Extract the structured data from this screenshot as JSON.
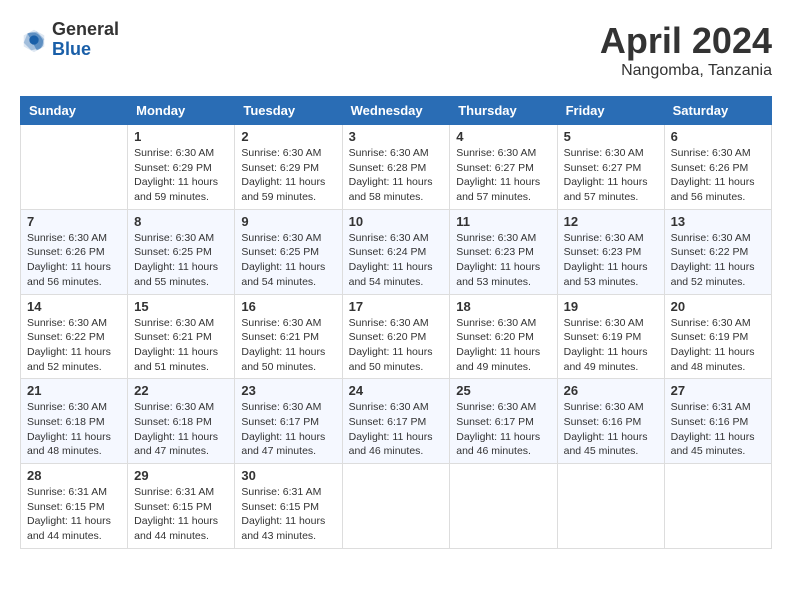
{
  "header": {
    "logo_general": "General",
    "logo_blue": "Blue",
    "month_title": "April 2024",
    "location": "Nangomba, Tanzania"
  },
  "calendar": {
    "days_of_week": [
      "Sunday",
      "Monday",
      "Tuesday",
      "Wednesday",
      "Thursday",
      "Friday",
      "Saturday"
    ],
    "weeks": [
      [
        {
          "day": "",
          "sunrise": "",
          "sunset": "",
          "daylight": ""
        },
        {
          "day": "1",
          "sunrise": "Sunrise: 6:30 AM",
          "sunset": "Sunset: 6:29 PM",
          "daylight": "Daylight: 11 hours and 59 minutes."
        },
        {
          "day": "2",
          "sunrise": "Sunrise: 6:30 AM",
          "sunset": "Sunset: 6:29 PM",
          "daylight": "Daylight: 11 hours and 59 minutes."
        },
        {
          "day": "3",
          "sunrise": "Sunrise: 6:30 AM",
          "sunset": "Sunset: 6:28 PM",
          "daylight": "Daylight: 11 hours and 58 minutes."
        },
        {
          "day": "4",
          "sunrise": "Sunrise: 6:30 AM",
          "sunset": "Sunset: 6:27 PM",
          "daylight": "Daylight: 11 hours and 57 minutes."
        },
        {
          "day": "5",
          "sunrise": "Sunrise: 6:30 AM",
          "sunset": "Sunset: 6:27 PM",
          "daylight": "Daylight: 11 hours and 57 minutes."
        },
        {
          "day": "6",
          "sunrise": "Sunrise: 6:30 AM",
          "sunset": "Sunset: 6:26 PM",
          "daylight": "Daylight: 11 hours and 56 minutes."
        }
      ],
      [
        {
          "day": "7",
          "sunrise": "Sunrise: 6:30 AM",
          "sunset": "Sunset: 6:26 PM",
          "daylight": "Daylight: 11 hours and 56 minutes."
        },
        {
          "day": "8",
          "sunrise": "Sunrise: 6:30 AM",
          "sunset": "Sunset: 6:25 PM",
          "daylight": "Daylight: 11 hours and 55 minutes."
        },
        {
          "day": "9",
          "sunrise": "Sunrise: 6:30 AM",
          "sunset": "Sunset: 6:25 PM",
          "daylight": "Daylight: 11 hours and 54 minutes."
        },
        {
          "day": "10",
          "sunrise": "Sunrise: 6:30 AM",
          "sunset": "Sunset: 6:24 PM",
          "daylight": "Daylight: 11 hours and 54 minutes."
        },
        {
          "day": "11",
          "sunrise": "Sunrise: 6:30 AM",
          "sunset": "Sunset: 6:23 PM",
          "daylight": "Daylight: 11 hours and 53 minutes."
        },
        {
          "day": "12",
          "sunrise": "Sunrise: 6:30 AM",
          "sunset": "Sunset: 6:23 PM",
          "daylight": "Daylight: 11 hours and 53 minutes."
        },
        {
          "day": "13",
          "sunrise": "Sunrise: 6:30 AM",
          "sunset": "Sunset: 6:22 PM",
          "daylight": "Daylight: 11 hours and 52 minutes."
        }
      ],
      [
        {
          "day": "14",
          "sunrise": "Sunrise: 6:30 AM",
          "sunset": "Sunset: 6:22 PM",
          "daylight": "Daylight: 11 hours and 52 minutes."
        },
        {
          "day": "15",
          "sunrise": "Sunrise: 6:30 AM",
          "sunset": "Sunset: 6:21 PM",
          "daylight": "Daylight: 11 hours and 51 minutes."
        },
        {
          "day": "16",
          "sunrise": "Sunrise: 6:30 AM",
          "sunset": "Sunset: 6:21 PM",
          "daylight": "Daylight: 11 hours and 50 minutes."
        },
        {
          "day": "17",
          "sunrise": "Sunrise: 6:30 AM",
          "sunset": "Sunset: 6:20 PM",
          "daylight": "Daylight: 11 hours and 50 minutes."
        },
        {
          "day": "18",
          "sunrise": "Sunrise: 6:30 AM",
          "sunset": "Sunset: 6:20 PM",
          "daylight": "Daylight: 11 hours and 49 minutes."
        },
        {
          "day": "19",
          "sunrise": "Sunrise: 6:30 AM",
          "sunset": "Sunset: 6:19 PM",
          "daylight": "Daylight: 11 hours and 49 minutes."
        },
        {
          "day": "20",
          "sunrise": "Sunrise: 6:30 AM",
          "sunset": "Sunset: 6:19 PM",
          "daylight": "Daylight: 11 hours and 48 minutes."
        }
      ],
      [
        {
          "day": "21",
          "sunrise": "Sunrise: 6:30 AM",
          "sunset": "Sunset: 6:18 PM",
          "daylight": "Daylight: 11 hours and 48 minutes."
        },
        {
          "day": "22",
          "sunrise": "Sunrise: 6:30 AM",
          "sunset": "Sunset: 6:18 PM",
          "daylight": "Daylight: 11 hours and 47 minutes."
        },
        {
          "day": "23",
          "sunrise": "Sunrise: 6:30 AM",
          "sunset": "Sunset: 6:17 PM",
          "daylight": "Daylight: 11 hours and 47 minutes."
        },
        {
          "day": "24",
          "sunrise": "Sunrise: 6:30 AM",
          "sunset": "Sunset: 6:17 PM",
          "daylight": "Daylight: 11 hours and 46 minutes."
        },
        {
          "day": "25",
          "sunrise": "Sunrise: 6:30 AM",
          "sunset": "Sunset: 6:17 PM",
          "daylight": "Daylight: 11 hours and 46 minutes."
        },
        {
          "day": "26",
          "sunrise": "Sunrise: 6:30 AM",
          "sunset": "Sunset: 6:16 PM",
          "daylight": "Daylight: 11 hours and 45 minutes."
        },
        {
          "day": "27",
          "sunrise": "Sunrise: 6:31 AM",
          "sunset": "Sunset: 6:16 PM",
          "daylight": "Daylight: 11 hours and 45 minutes."
        }
      ],
      [
        {
          "day": "28",
          "sunrise": "Sunrise: 6:31 AM",
          "sunset": "Sunset: 6:15 PM",
          "daylight": "Daylight: 11 hours and 44 minutes."
        },
        {
          "day": "29",
          "sunrise": "Sunrise: 6:31 AM",
          "sunset": "Sunset: 6:15 PM",
          "daylight": "Daylight: 11 hours and 44 minutes."
        },
        {
          "day": "30",
          "sunrise": "Sunrise: 6:31 AM",
          "sunset": "Sunset: 6:15 PM",
          "daylight": "Daylight: 11 hours and 43 minutes."
        },
        {
          "day": "",
          "sunrise": "",
          "sunset": "",
          "daylight": ""
        },
        {
          "day": "",
          "sunrise": "",
          "sunset": "",
          "daylight": ""
        },
        {
          "day": "",
          "sunrise": "",
          "sunset": "",
          "daylight": ""
        },
        {
          "day": "",
          "sunrise": "",
          "sunset": "",
          "daylight": ""
        }
      ]
    ]
  }
}
